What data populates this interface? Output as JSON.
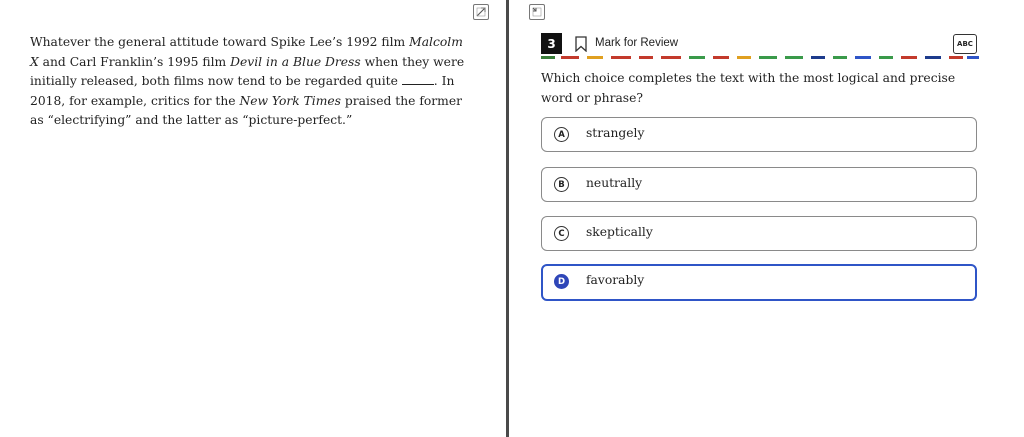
{
  "passage": {
    "seg1": "Whatever the general attitude toward Spike Lee’s 1992 film ",
    "film1": "Malcolm X",
    "seg2": " and Carl Franklin’s 1995 film ",
    "film2": "Devil in a Blue Dress",
    "seg3": " when they were initially released, both films now tend to be regarded quite ",
    "seg4": ". In 2018, for example, critics for the ",
    "publication": "New York Times",
    "seg5": " praised the former as “electrifying” and the latter as “picture-perfect.”"
  },
  "question": {
    "number": "3",
    "mark_label": "Mark for Review",
    "tool_label": "ABC",
    "prompt": "Which choice completes the text with the most logical and precise word or phrase?",
    "options": [
      {
        "letter": "A",
        "text": "strangely"
      },
      {
        "letter": "B",
        "text": "neutrally"
      },
      {
        "letter": "C",
        "text": "skeptically"
      },
      {
        "letter": "D",
        "text": "favorably"
      }
    ],
    "selected": "D"
  },
  "colors": {
    "accent": "#2f46b8",
    "selected_border": "#2f55c7",
    "divider": "#4a4a4a",
    "dash_strip": [
      "#3a7d3a",
      "#c33a2c",
      "#e0a020",
      "#3a9a4a",
      "#2f55c7",
      "#c33a2c",
      "#1d3b8c"
    ]
  },
  "icons": {
    "expand_left": "expand-arrows-icon",
    "expand_right": "collapse-arrows-icon",
    "bookmark": "bookmark-icon",
    "abc": "abc-strikethrough-icon"
  }
}
